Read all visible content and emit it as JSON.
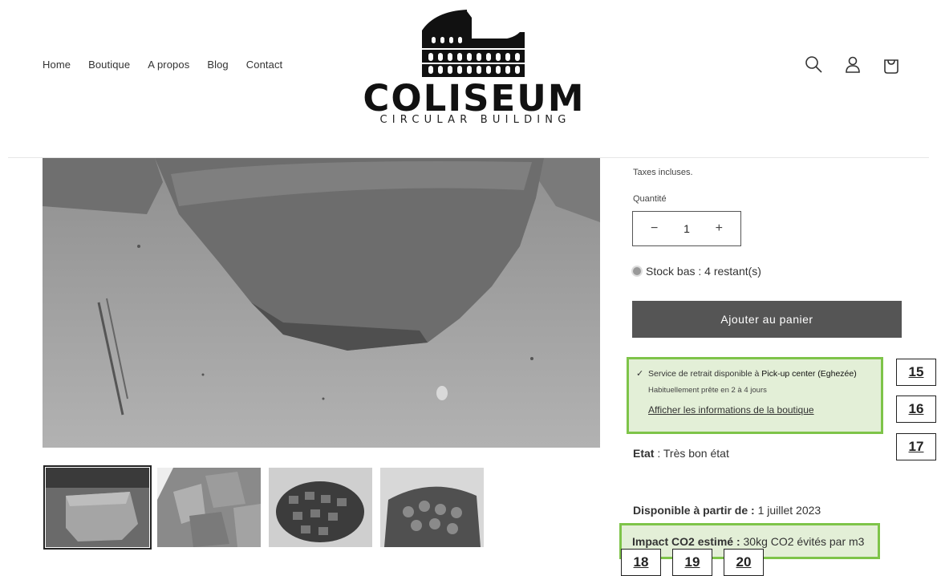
{
  "nav": {
    "items": [
      "Home",
      "Boutique",
      "A propos",
      "Blog",
      "Contact"
    ]
  },
  "logo": {
    "word": "COLISEUM",
    "tagline": "CIRCULAR BUILDING"
  },
  "header_icons": [
    "search-icon",
    "account-icon",
    "cart-icon"
  ],
  "product": {
    "tax_note": "Taxes incluses.",
    "quantity_label": "Quantité",
    "quantity_value": "1",
    "decrease_label": "−",
    "increase_label": "+",
    "stock_text": "Stock bas : 4 restant(s)",
    "add_to_cart": "Ajouter au panier"
  },
  "pickup": {
    "check": "✓",
    "line1_prefix": "Service de retrait disponible à ",
    "line1_location": "Pick-up center (Eghezée)",
    "line2": "Habituellement prête en 2 à 4 jours",
    "link": "Afficher les informations de la boutique"
  },
  "details": {
    "etat_label": "Etat",
    "etat_value": " : Très bon état",
    "dispo_label": "Disponible à partir de :",
    "dispo_value": " 1 juillet 2023",
    "impact_label": "Impact CO2 estimé :",
    "impact_value": " 30kg CO2 évités par m3"
  },
  "annotations": [
    "15",
    "16",
    "17",
    "18",
    "19",
    "20"
  ],
  "colors": {
    "highlight_border": "#7ec449",
    "highlight_fill": "#e3efd7",
    "button": "#555555"
  }
}
